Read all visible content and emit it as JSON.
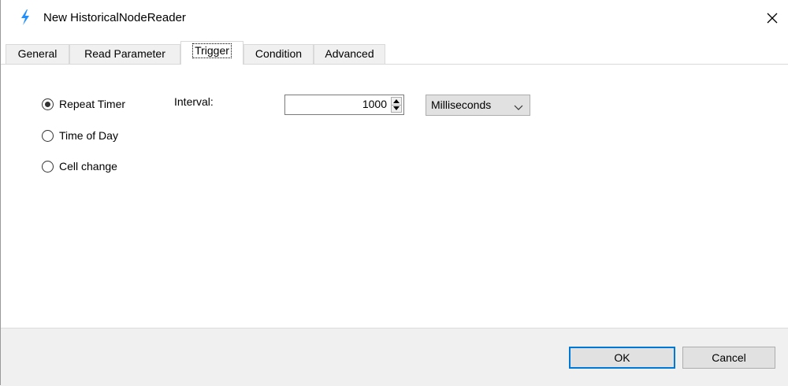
{
  "window": {
    "title": "New HistoricalNodeReader",
    "icon": "lightning-icon",
    "close_icon": "close-icon"
  },
  "tabs": [
    {
      "label": "General",
      "active": false
    },
    {
      "label": "Read Parameter",
      "active": false
    },
    {
      "label": "Trigger",
      "active": true
    },
    {
      "label": "Condition",
      "active": false
    },
    {
      "label": "Advanced",
      "active": false
    }
  ],
  "trigger": {
    "options": [
      {
        "label": "Repeat Timer",
        "checked": true
      },
      {
        "label": "Time of Day",
        "checked": false
      },
      {
        "label": "Cell change",
        "checked": false
      }
    ],
    "interval_label": "Interval:",
    "interval_value": "1000",
    "unit_selected": "Milliseconds"
  },
  "footer": {
    "ok_label": "OK",
    "cancel_label": "Cancel"
  },
  "colors": {
    "accent": "#0078d7",
    "icon": "#1e90ff",
    "footer_bg": "#f0f0f0",
    "button_bg": "#e1e1e1"
  }
}
